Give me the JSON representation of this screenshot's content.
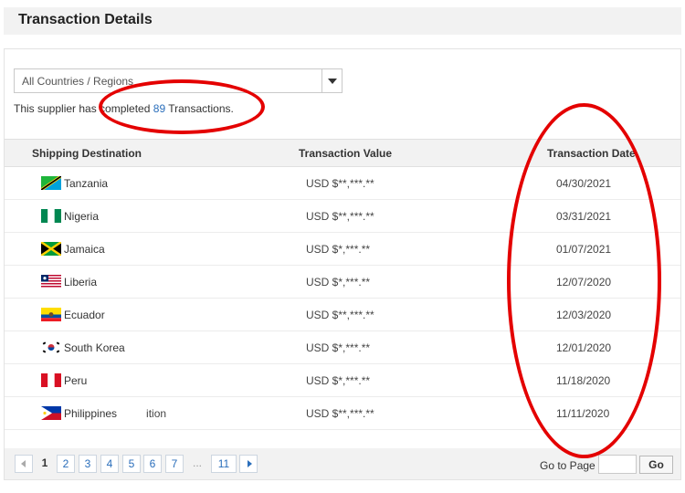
{
  "header": {
    "title": "Transaction Details"
  },
  "filter": {
    "selected": "All Countries / Regions"
  },
  "summary": {
    "prefix": "This supplier has completed",
    "count": "89",
    "suffix": "Transactions."
  },
  "table": {
    "columns": [
      "Shipping Destination",
      "Transaction Value",
      "Transaction Date"
    ],
    "rows": [
      {
        "destination": "Tanzania",
        "value": "USD $**,***.**",
        "date": "04/30/2021",
        "flag": "tanzania-flag-icon"
      },
      {
        "destination": "Nigeria",
        "value": "USD $**,***.**",
        "date": "03/31/2021",
        "flag": "nigeria-flag-icon"
      },
      {
        "destination": "Jamaica",
        "value": "USD $*,***.**",
        "date": "01/07/2021",
        "flag": "jamaica-flag-icon"
      },
      {
        "destination": "Liberia",
        "value": "USD $*,***.**",
        "date": "12/07/2020",
        "flag": "liberia-flag-icon"
      },
      {
        "destination": "Ecuador",
        "value": "USD $**,***.**",
        "date": "12/03/2020",
        "flag": "ecuador-flag-icon"
      },
      {
        "destination": "South Korea",
        "value": "USD $*,***.**",
        "date": "12/01/2020",
        "flag": "south-korea-flag-icon"
      },
      {
        "destination": "Peru",
        "value": "USD $*,***.**",
        "date": "11/18/2020",
        "flag": "peru-flag-icon"
      },
      {
        "destination": "Philippines",
        "extra": "ition",
        "value": "USD $**,***.**",
        "date": "11/11/2020",
        "flag": "philippines-flag-icon"
      }
    ]
  },
  "pagination": {
    "pages": [
      "1",
      "2",
      "3",
      "4",
      "5",
      "6",
      "7"
    ],
    "current": "1",
    "ellipsis": "...",
    "last": "11",
    "goto_label": "Go to Page",
    "go_button": "Go",
    "goto_value": ""
  },
  "colors": {
    "annotation": "#e40000",
    "link": "#2a6ebb",
    "header_bg": "#f2f2f2"
  }
}
